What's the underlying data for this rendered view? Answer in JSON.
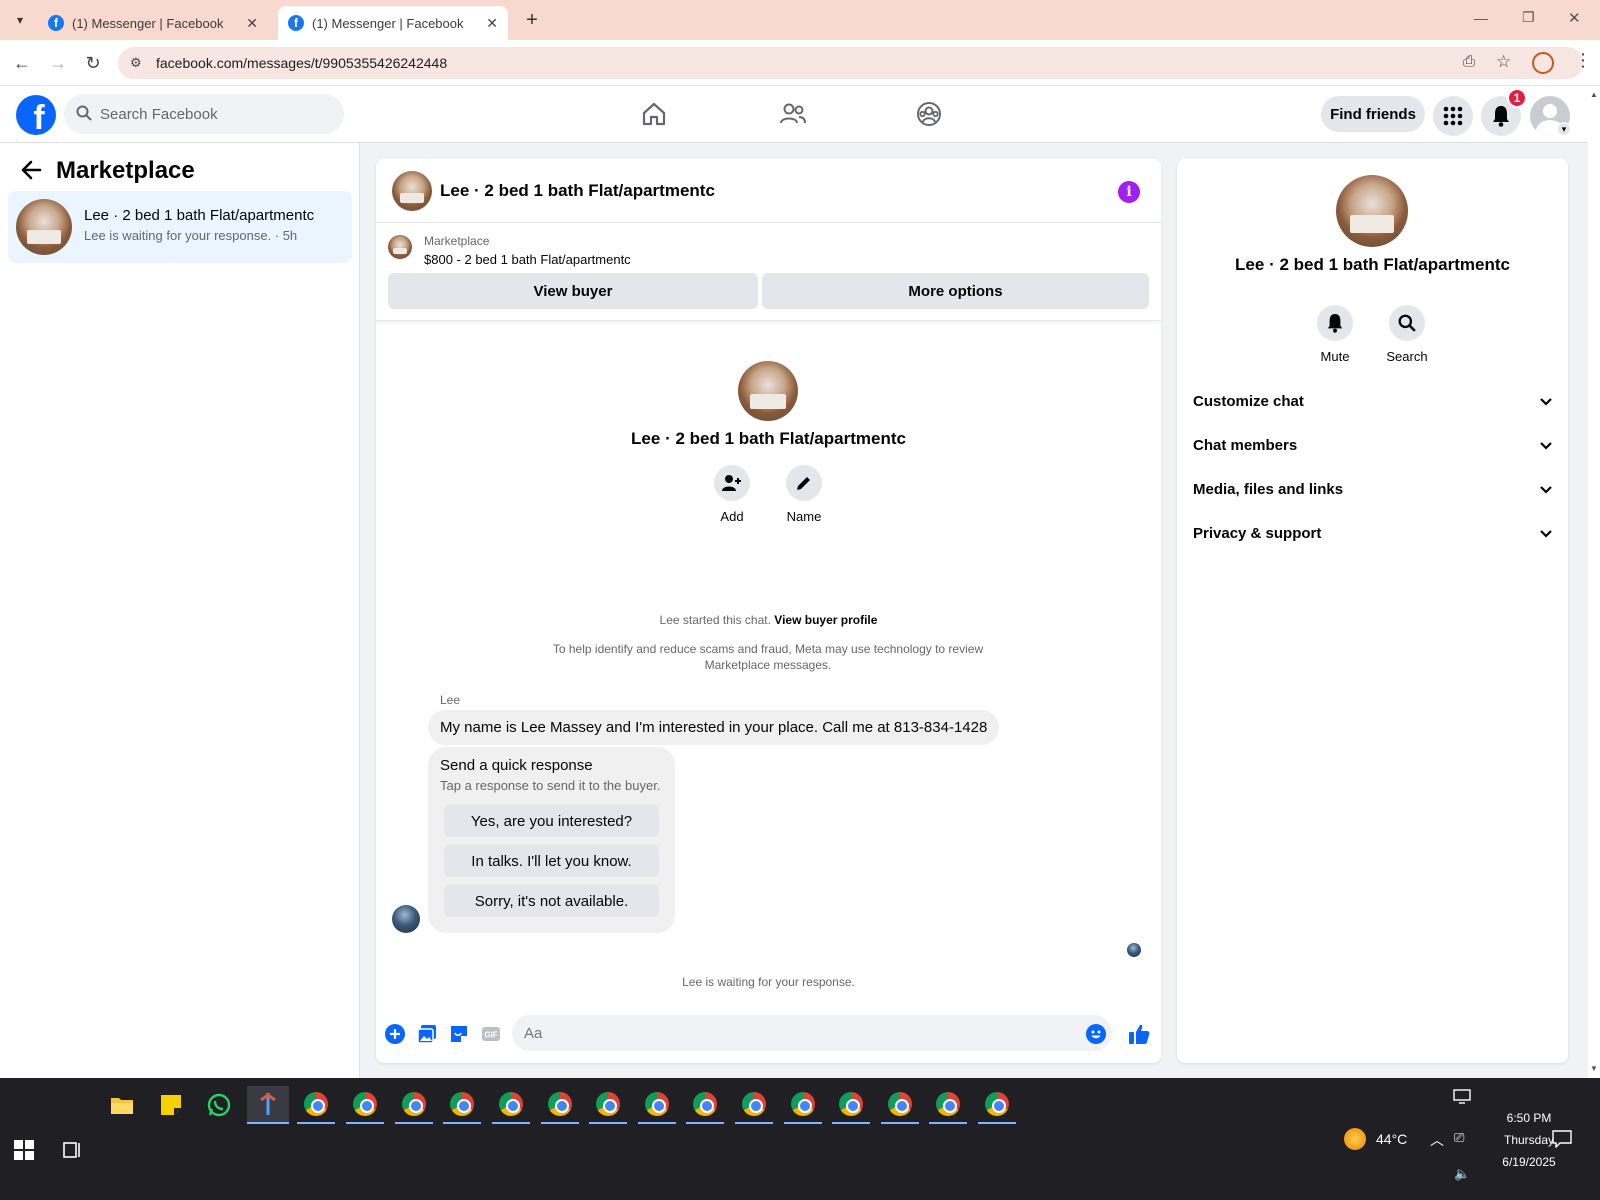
{
  "browser": {
    "tabs": [
      {
        "title": "(1) Messenger | Facebook"
      },
      {
        "title": "(1) Messenger | Facebook"
      }
    ],
    "url": "facebook.com/messages/t/9905355426242448"
  },
  "fb_header": {
    "search_placeholder": "Search Facebook",
    "find_friends": "Find friends",
    "notif_count": "1"
  },
  "left_panel": {
    "title": "Marketplace",
    "conversation": {
      "name": "Lee · 2 bed 1 bath Flat/apartmentc",
      "subtitle": "Lee is waiting for your response. · 5h"
    }
  },
  "chat": {
    "title": "Lee · 2 bed 1 bath Flat/apartmentc",
    "listing_label": "Marketplace",
    "listing_price": "$800 - 2 bed 1 bath Flat/apartmentc",
    "view_buyer": "View buyer",
    "more_options": "More options",
    "profile_name": "Lee · 2 bed 1 bath Flat/apartmentc",
    "add_label": "Add",
    "name_label": "Name",
    "started_text": "Lee started this chat.",
    "view_buyer_profile": "View buyer profile",
    "scam_note": "To help identify and reduce scams and fraud, Meta may use technology to review Marketplace messages.",
    "sender": "Lee",
    "message": "My name is Lee Massey and I'm interested in your place. Call me at 813-834-1428",
    "quick_title": "Send a quick response",
    "quick_subtitle": "Tap a response to send it to the buyer.",
    "quick_responses": [
      "Yes, are you interested?",
      "In talks. I'll let you know.",
      "Sorry, it's not available."
    ],
    "waiting": "Lee is waiting for your response.",
    "input_placeholder": "Aa"
  },
  "right_panel": {
    "name": "Lee · 2 bed 1 bath Flat/apartmentc",
    "mute": "Mute",
    "search": "Search",
    "sections": [
      "Customize chat",
      "Chat members",
      "Media, files and links",
      "Privacy & support"
    ]
  },
  "taskbar": {
    "temperature": "44°C",
    "time": "6:50 PM",
    "day": "Thursday",
    "date": "6/19/2025"
  }
}
